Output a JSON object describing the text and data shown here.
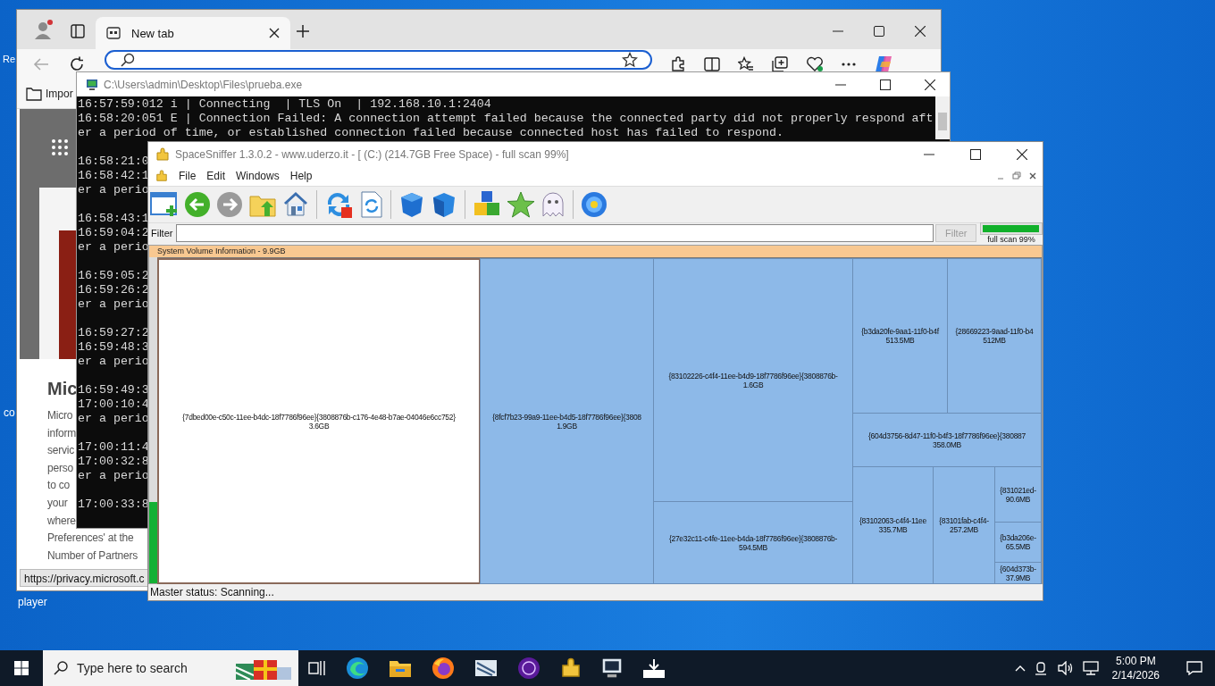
{
  "desktop": {
    "icon_labels": [
      "Re",
      "co",
      "player"
    ]
  },
  "browser": {
    "tabs": [
      {
        "label": "New tab",
        "selected": true
      }
    ],
    "favorites": [
      "Impor"
    ],
    "page": {
      "heading": "Mic",
      "lines": [
        "Micro",
        "inform",
        "servic",
        "perso",
        "to co",
        "your",
        "where",
        "Preferences' at the",
        "Number of Partners"
      ]
    },
    "status_url": "https://privacy.microsoft.c"
  },
  "console": {
    "title": "C:\\Users\\admin\\Desktop\\Files\\prueba.exe",
    "blocks": [
      [
        "16:57:59:012 i | Connecting  | TLS On  | 192.168.10.1:2404",
        "16:58:20:051 E | Connection Failed: A connection attempt failed because the connected party did not properly respond aft",
        "er a period of time, or established connection failed because connected host has failed to respond."
      ],
      [
        "16:58:21:0",
        "16:58:42:1",
        "er a perio"
      ],
      [
        "16:58:43:1",
        "16:59:04:2",
        "er a perio"
      ],
      [
        "16:59:05:2",
        "16:59:26:2",
        "er a perio"
      ],
      [
        "16:59:27:2",
        "16:59:48:3",
        "er a perio"
      ],
      [
        "16:59:49:3",
        "17:00:10:4",
        "er a perio"
      ],
      [
        "17:00:11:4",
        "17:00:32:8",
        "er a perio"
      ],
      [
        "17:00:33:8"
      ]
    ]
  },
  "sniffer": {
    "title": "SpaceSniffer 1.3.0.2 - www.uderzo.it - [ (C:) (214.7GB Free Space) - full scan 99%]",
    "menu": [
      "File",
      "Edit",
      "Windows",
      "Help"
    ],
    "filter": {
      "label": "Filter",
      "button": "Filter",
      "button_disabled": true
    },
    "progress": {
      "level": 0.99,
      "label": "full scan 99%"
    },
    "treemap": {
      "header": "System Volume Information - 9.9GB",
      "cells": [
        {
          "name": "{7dbed00e-c50c-11ee-b4dc-18f7786f96ee}{3808876b-c176-4e48-b7ae-04046e6cc752}",
          "size": "3.6GB",
          "selected": true
        },
        {
          "name": "{8fcf7b23-99a9-11ee-b4d5-18f7786f96ee}{3808",
          "size": "1.9GB",
          "selected": false
        },
        {
          "name": "{83102226-c4f4-11ee-b4d9-18f7786f96ee}{3808876b-",
          "size": "1.6GB",
          "selected": false
        },
        {
          "name": "{27e32c11-c4fe-11ee-b4da-18f7786f96ee}{3808876b-",
          "size": "594.5MB",
          "selected": false
        },
        {
          "name": "{b3da20fe-9aa1-11f0-b4f",
          "size": "513.5MB",
          "selected": false
        },
        {
          "name": "{28669223-9aad-11f0-b4",
          "size": "512MB",
          "selected": false
        },
        {
          "name": "{604d3756-8d47-11f0-b4f3-18f7786f96ee}{380887",
          "size": "358.0MB",
          "selected": false
        },
        {
          "name": "{83102063-c4f4-11ee",
          "size": "335.7MB",
          "selected": false
        },
        {
          "name": "{83101fab-c4f4-",
          "size": "257.2MB",
          "selected": false
        },
        {
          "name": "{831021ed-",
          "size": "90.6MB",
          "selected": false
        },
        {
          "name": "{b3da206e-",
          "size": "65.5MB",
          "selected": false
        },
        {
          "name": "{604d373b-",
          "size": "37.9MB",
          "selected": false
        }
      ]
    },
    "status": "Master status: Scanning..."
  },
  "taskbar": {
    "search_placeholder": "Type here to search",
    "time": "5:00 PM",
    "date": "2/14/2026"
  }
}
